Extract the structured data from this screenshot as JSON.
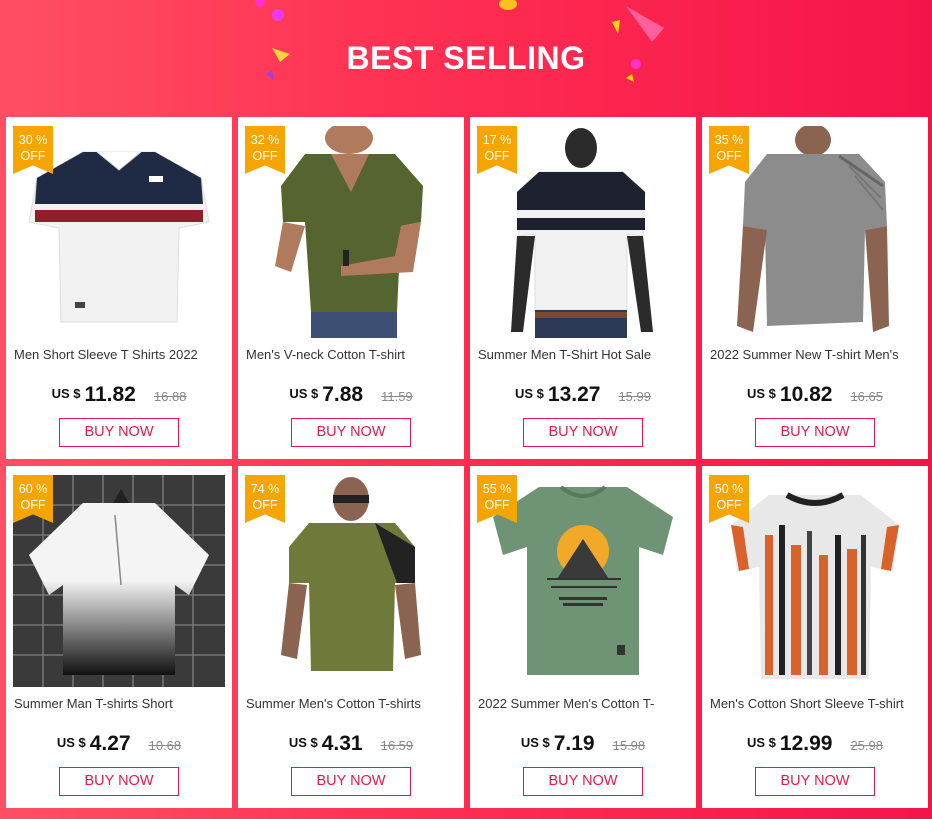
{
  "header": {
    "title": "BEST SELLING"
  },
  "colors": {
    "accent": "#e8194a",
    "badge": "#f6a400",
    "background": "#ff2f52"
  },
  "products": [
    {
      "name": "Men Short Sleeve T Shirts 2022",
      "discount": "30 %",
      "off": "OFF",
      "currency": "US $",
      "price": "11.82",
      "old_price": "16.88",
      "buy": "BUY NOW",
      "image": "white-navy-red-striped-vneck-tshirt"
    },
    {
      "name": "Men's V-neck  Cotton T-shirt",
      "discount": "32 %",
      "off": "OFF",
      "currency": "US $",
      "price": "7.88",
      "old_price": "11.59",
      "buy": "BUY NOW",
      "image": "olive-vneck-tshirt-model"
    },
    {
      "name": "Summer Men T-Shirt Hot Sale",
      "discount": "17 %",
      "off": "OFF",
      "currency": "US $",
      "price": "13.27",
      "old_price": "15.99",
      "buy": "BUY NOW",
      "image": "white-black-striped-tshirt-mannequin"
    },
    {
      "name": "2022 Summer New T-shirt Men's",
      "discount": "35 %",
      "off": "OFF",
      "currency": "US $",
      "price": "10.82",
      "old_price": "16.65",
      "buy": "BUY NOW",
      "image": "grey-pleated-shoulder-tshirt-model"
    },
    {
      "name": "Summer Man T-shirts Short",
      "discount": "60 %",
      "off": "OFF",
      "currency": "US $",
      "price": "4.27",
      "old_price": "10.68",
      "buy": "BUY NOW",
      "image": "white-black-gradient-tshirt"
    },
    {
      "name": "Summer Men's Cotton T-shirts",
      "discount": "74 %",
      "off": "OFF",
      "currency": "US $",
      "price": "4.31",
      "old_price": "16.59",
      "buy": "BUY NOW",
      "image": "olive-raglan-tshirt-model"
    },
    {
      "name": "2022 Summer Men's Cotton T-",
      "discount": "55 %",
      "off": "OFF",
      "currency": "US $",
      "price": "7.19",
      "old_price": "15.98",
      "buy": "BUY NOW",
      "image": "green-pyramid-print-tshirt"
    },
    {
      "name": "Men's Cotton Short Sleeve T-shirt",
      "discount": "50 %",
      "off": "OFF",
      "currency": "US $",
      "price": "12.99",
      "old_price": "25.98",
      "buy": "BUY NOW",
      "image": "orange-black-striped-tshirt"
    }
  ]
}
